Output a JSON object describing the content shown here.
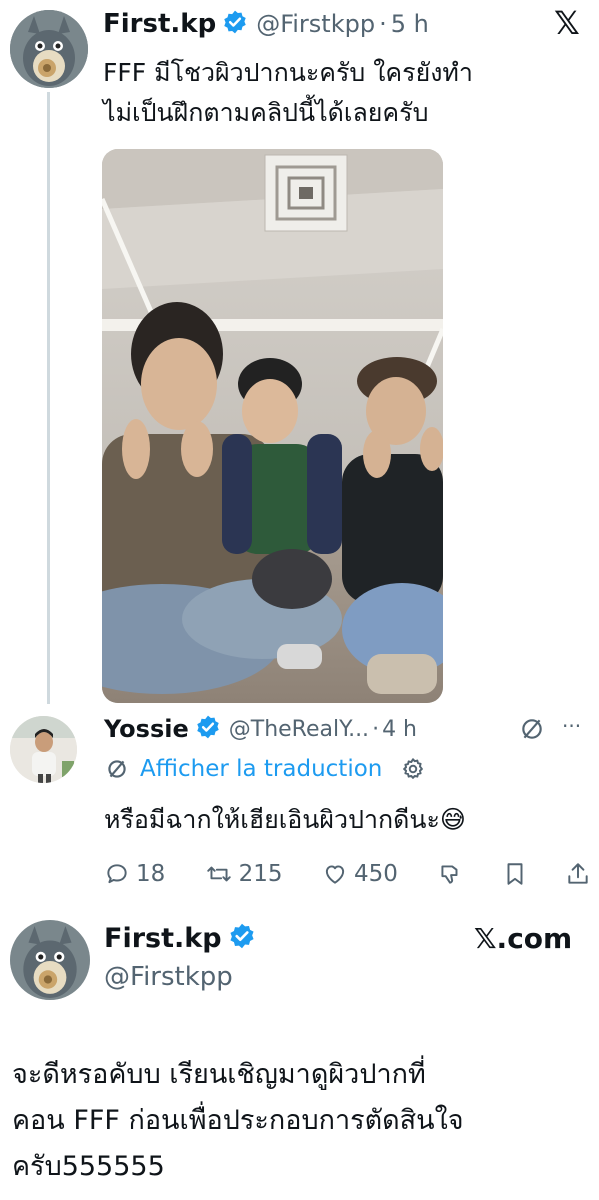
{
  "tweet1": {
    "display_name": "First.kp",
    "handle": "@Firstkpp",
    "separator": "·",
    "time": "5 h",
    "text_line1": "FFF มีโชวผิวปากนะครับ  ใครยังทำ",
    "text_line2": "ไม่เป็นฝึกตามคลิปนี้ได้เลยครับ",
    "x_logo": "𝕏"
  },
  "reply": {
    "display_name": "Yossie",
    "handle": "@TheRealY...",
    "separator": "·",
    "time": "4 h",
    "more": "···",
    "translate_label": "Afficher la traduction",
    "text": "หรือมีฉากให้เฮียเอินผิวปากดีนะ😅",
    "reply_count": "18",
    "retweet_count": "215",
    "like_count": "450"
  },
  "tweet2": {
    "display_name": "First.kp",
    "handle": "@Firstkpp",
    "brand": "𝕏.com",
    "text_line1": "จะดีหรอคับบ เรียนเชิญมาดูผิวปากที่",
    "text_line2": "คอน FFF ก่อนเพื่อประกอบการตัดสินใจ",
    "text_line3": "ครับ555555"
  },
  "colors": {
    "accent": "#1d9bf0",
    "text": "#0f1419",
    "muted": "#536471",
    "line": "#cfd9de"
  }
}
